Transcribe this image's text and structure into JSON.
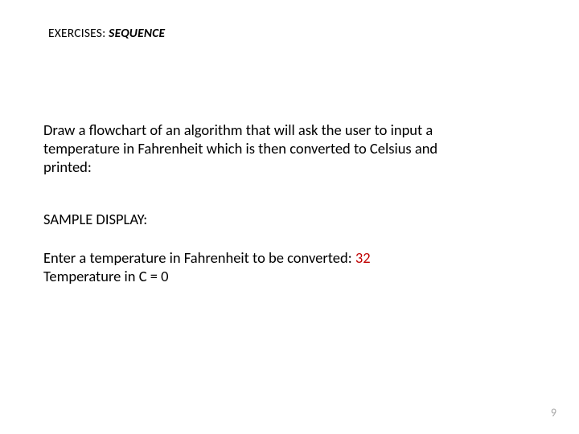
{
  "title": {
    "label": "EXERCISES:",
    "topic": "SEQUENCE"
  },
  "body": {
    "instruction_l1": "Draw a flowchart of an algorithm that will ask the user to input a",
    "instruction_l2": "temperature in Fahrenheit which is then converted to Celsius and",
    "instruction_l3": "printed:",
    "sample_heading": "SAMPLE DISPLAY:",
    "sample_l1_text": "Enter a temperature in Fahrenheit to be converted: ",
    "sample_l1_value": "32",
    "sample_l2": "Temperature in C = 0"
  },
  "page_number": "9"
}
